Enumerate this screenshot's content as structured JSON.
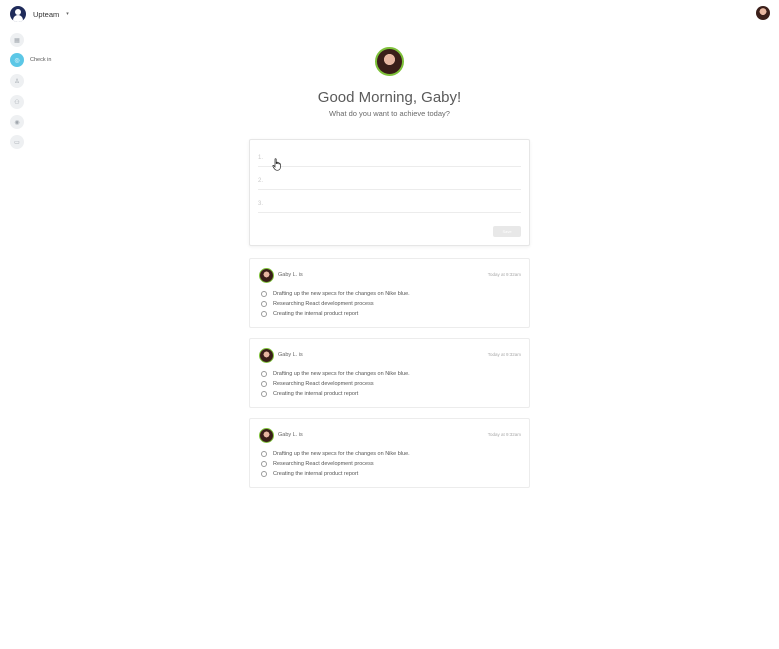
{
  "header": {
    "workspace_name": "Upteam",
    "workspace_caret": "▾"
  },
  "sidebar": {
    "items": [
      {
        "icon": "grid-icon",
        "glyph": "▦",
        "label": ""
      },
      {
        "icon": "check-in-icon",
        "glyph": "◎",
        "label": "Check in",
        "active": true
      },
      {
        "icon": "person-icon",
        "glyph": "♙",
        "label": ""
      },
      {
        "icon": "team-icon",
        "glyph": "⚇",
        "label": ""
      },
      {
        "icon": "target-icon",
        "glyph": "◉",
        "label": ""
      },
      {
        "icon": "card-icon",
        "glyph": "▭",
        "label": ""
      }
    ]
  },
  "hero": {
    "greeting": "Good Morning, Gaby!",
    "subheading": "What do you want to achieve today?"
  },
  "goal_form": {
    "goals": [
      {
        "number": "1.",
        "value": "",
        "placeholder": ""
      },
      {
        "number": "2.",
        "value": "",
        "placeholder": ""
      },
      {
        "number": "3.",
        "value": "",
        "placeholder": ""
      }
    ],
    "save_label": "Save"
  },
  "feed": [
    {
      "name": "Gaby L. is",
      "time": "Today at 9:32am",
      "tasks": [
        "Drafting up the new specs for the changes on Nike blue.",
        "Researching React development process",
        "Creating the internal product report"
      ]
    },
    {
      "name": "Gaby L. is",
      "time": "Today at 9:32am",
      "tasks": [
        "Drafting up the new specs for the changes on Nike blue.",
        "Researching React development process",
        "Creating the internal product report"
      ]
    },
    {
      "name": "Gaby L. is",
      "time": "Today at 9:32am",
      "tasks": [
        "Drafting up the new specs for the changes on Nike blue.",
        "Researching React development process",
        "Creating the internal product report"
      ]
    }
  ],
  "colors": {
    "accent": "#5cc7e6",
    "avatar_ring": "#7ec13a",
    "workspace_logo": "#1f2b5a"
  }
}
